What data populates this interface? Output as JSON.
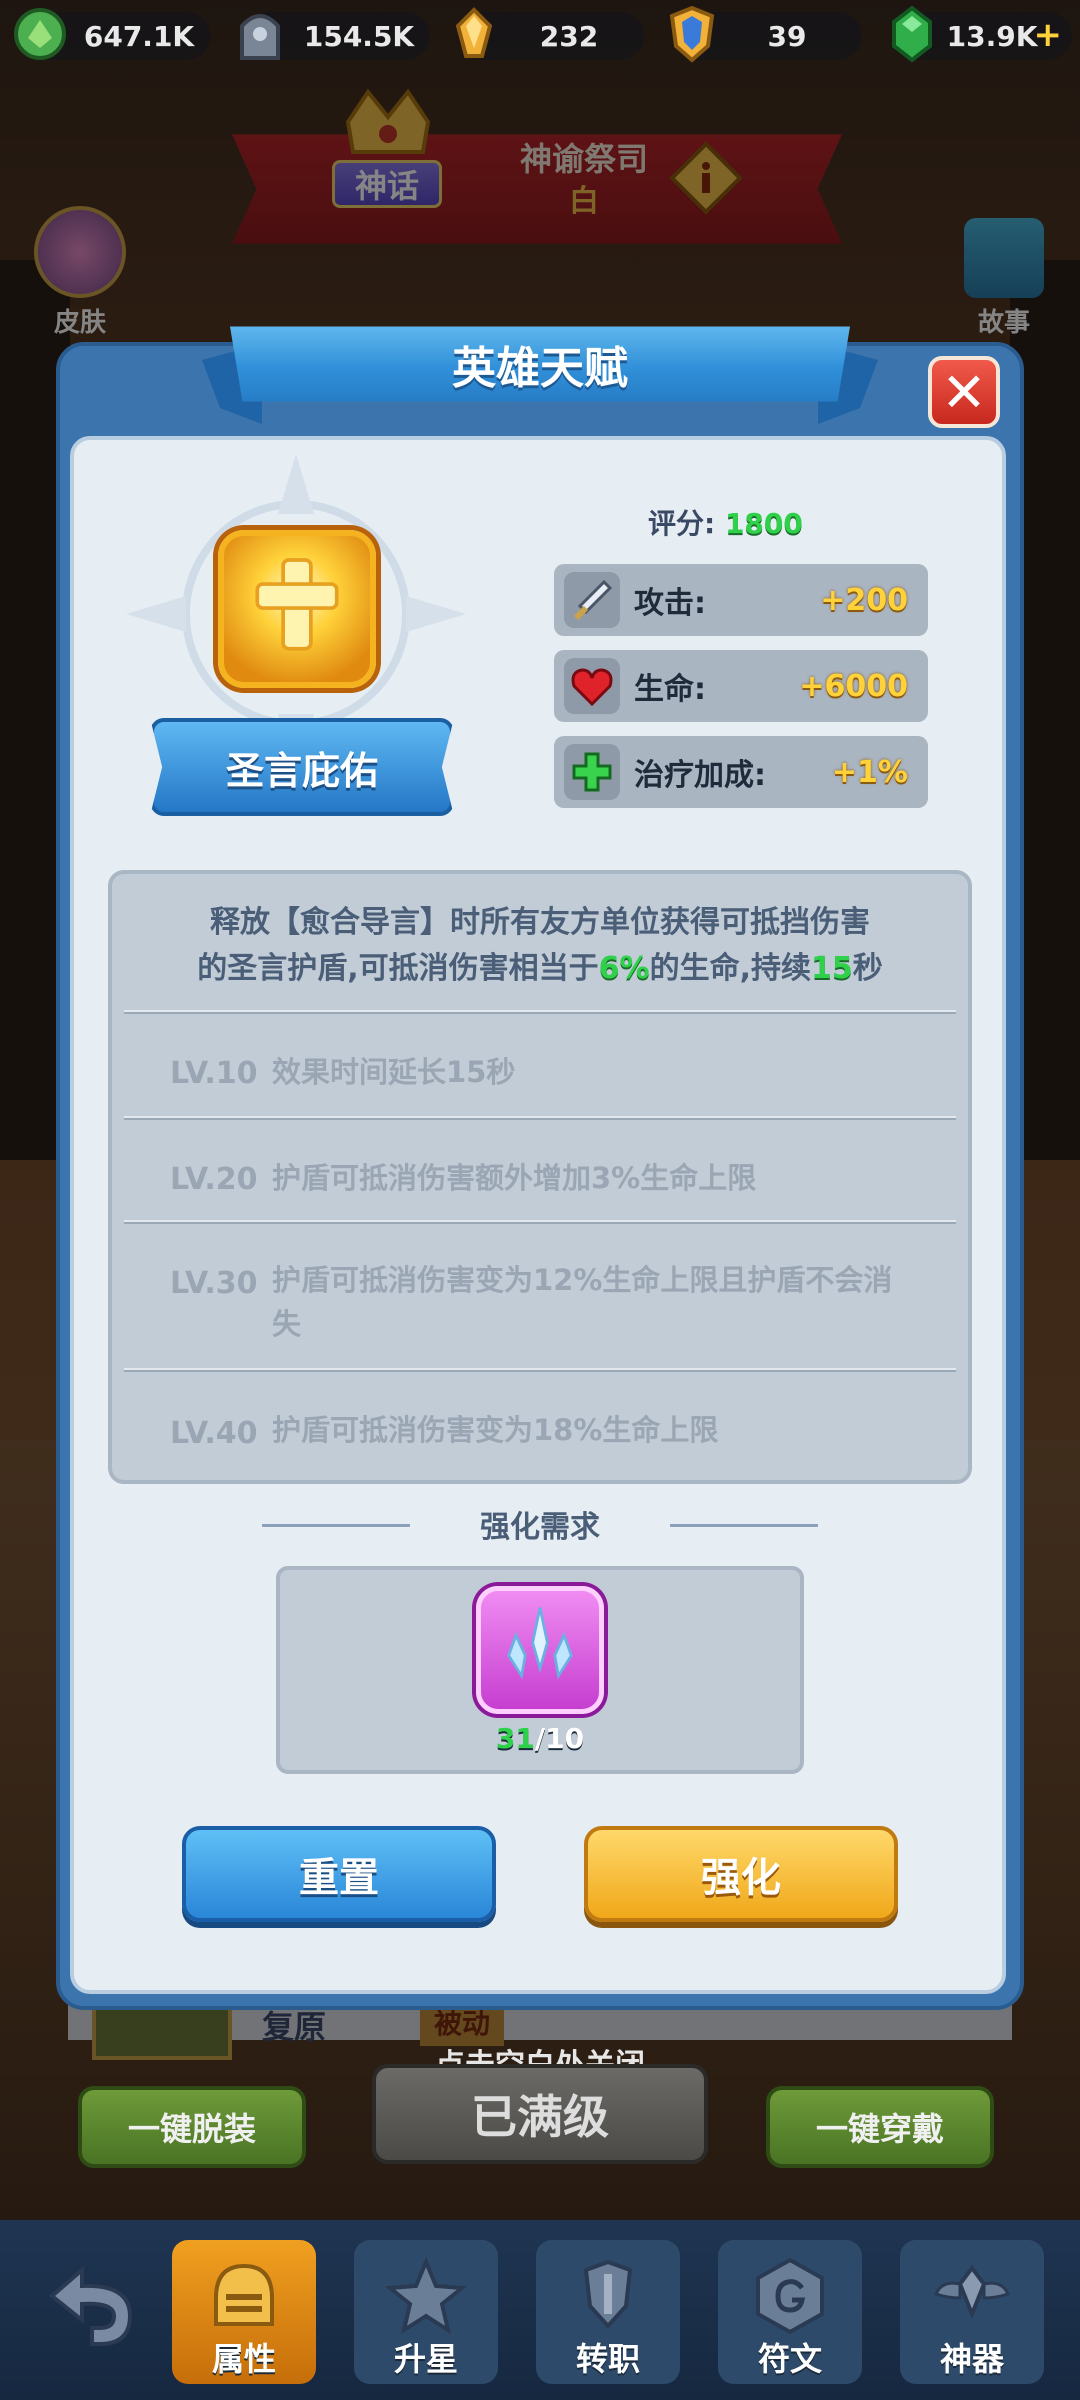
{
  "resources": [
    {
      "icon": "green-leaf-gem-icon",
      "value": "647.1K"
    },
    {
      "icon": "tombstone-icon",
      "value": "154.5K"
    },
    {
      "icon": "gold-crystal-icon",
      "value": "232"
    },
    {
      "icon": "blue-shield-icon",
      "value": "39"
    },
    {
      "icon": "emerald-gem-icon",
      "value": "13.9K"
    }
  ],
  "hero": {
    "myth_badge": "神话",
    "class_name": "神谕祭司",
    "grade": "白",
    "left_button": "皮肤",
    "right_button": "故事"
  },
  "modal": {
    "title": "英雄天赋",
    "talent_name": "圣言庇佑",
    "score_label": "评分:",
    "score_value": "1800",
    "stats": [
      {
        "icon": "sword-icon",
        "label": "攻击:",
        "value": "+200"
      },
      {
        "icon": "heart-icon",
        "label": "生命:",
        "value": "+6000"
      },
      {
        "icon": "green-cross-icon",
        "label": "治疗加成:",
        "value": "+1%"
      }
    ],
    "description": {
      "line1": "释放【愈合导言】时所有友方单位获得可抵挡伤害",
      "line2_a": "的圣言护盾,可抵消伤害相当于",
      "pct": "6%",
      "line2_b": "的生命,持续",
      "secs": "15",
      "line2_c": "秒"
    },
    "levels": [
      {
        "lv": "LV.10",
        "text": "效果时间延长15秒"
      },
      {
        "lv": "LV.20",
        "text": "护盾可抵消伤害额外增加3%生命上限"
      },
      {
        "lv": "LV.30",
        "text": "护盾可抵消伤害变为12%生命上限且护盾不会消失"
      },
      {
        "lv": "LV.40",
        "text": "护盾可抵消伤害变为18%生命上限"
      }
    ],
    "requirement_title": "强化需求",
    "crystal_have": "31",
    "crystal_need": "/10",
    "reset_button": "重置",
    "upgrade_button": "强化"
  },
  "close_hint": "点击空白处关闭",
  "background": {
    "item_name": "复原",
    "item_tag": "被动"
  },
  "actions": {
    "unequip_all": "一键脱装",
    "max_level": "已满级",
    "equip_all": "一键穿戴"
  },
  "nav": [
    {
      "label": "属性",
      "icon": "knight-helmet-icon",
      "active": true
    },
    {
      "label": "升星",
      "icon": "star-icon",
      "active": false
    },
    {
      "label": "转职",
      "icon": "sword-shield-icon",
      "active": false
    },
    {
      "label": "符文",
      "icon": "rune-stone-icon",
      "active": false
    },
    {
      "label": "神器",
      "icon": "winged-emblem-icon",
      "active": false
    }
  ]
}
